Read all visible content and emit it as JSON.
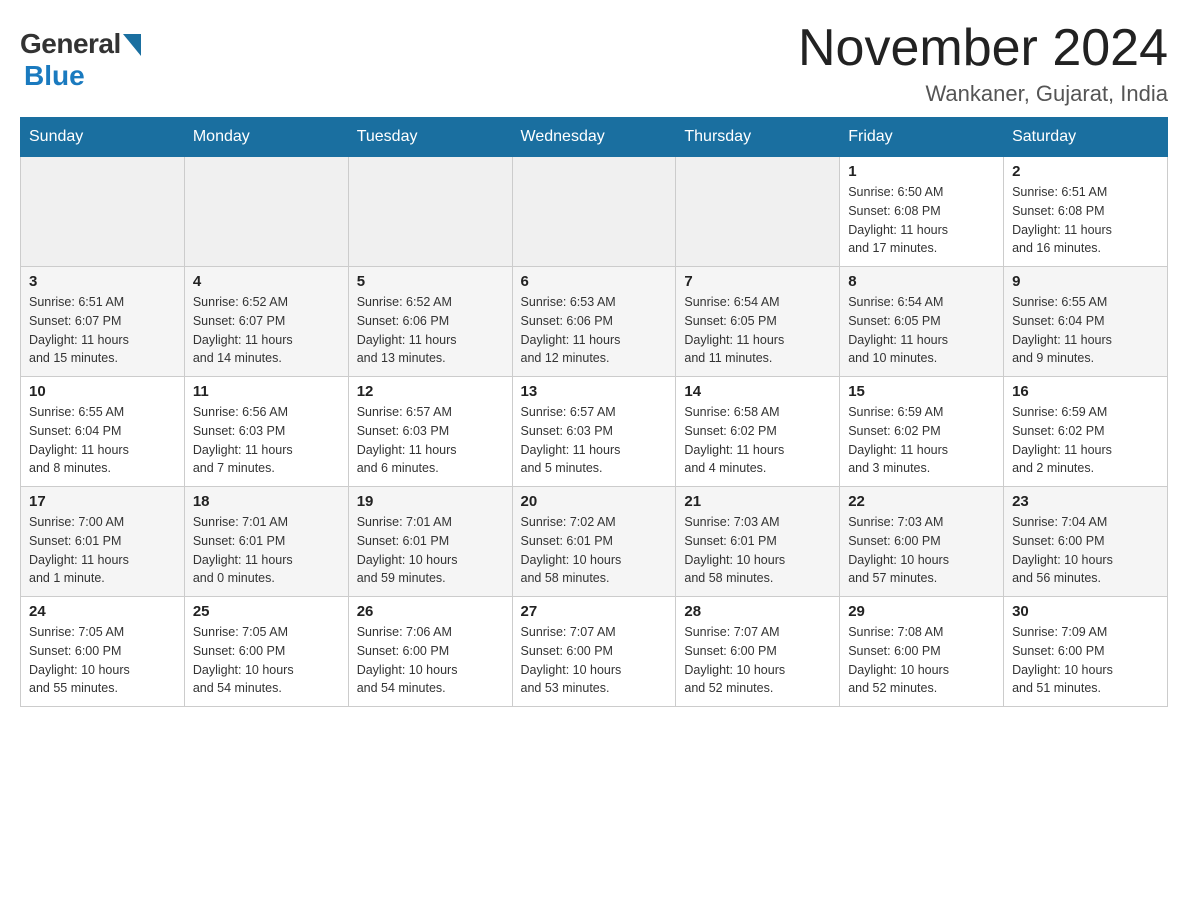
{
  "header": {
    "logo": {
      "general_text": "General",
      "blue_text": "Blue"
    },
    "title": "November 2024",
    "location": "Wankaner, Gujarat, India"
  },
  "days_of_week": [
    "Sunday",
    "Monday",
    "Tuesday",
    "Wednesday",
    "Thursday",
    "Friday",
    "Saturday"
  ],
  "weeks": [
    [
      {
        "day": "",
        "info": ""
      },
      {
        "day": "",
        "info": ""
      },
      {
        "day": "",
        "info": ""
      },
      {
        "day": "",
        "info": ""
      },
      {
        "day": "",
        "info": ""
      },
      {
        "day": "1",
        "info": "Sunrise: 6:50 AM\nSunset: 6:08 PM\nDaylight: 11 hours\nand 17 minutes."
      },
      {
        "day": "2",
        "info": "Sunrise: 6:51 AM\nSunset: 6:08 PM\nDaylight: 11 hours\nand 16 minutes."
      }
    ],
    [
      {
        "day": "3",
        "info": "Sunrise: 6:51 AM\nSunset: 6:07 PM\nDaylight: 11 hours\nand 15 minutes."
      },
      {
        "day": "4",
        "info": "Sunrise: 6:52 AM\nSunset: 6:07 PM\nDaylight: 11 hours\nand 14 minutes."
      },
      {
        "day": "5",
        "info": "Sunrise: 6:52 AM\nSunset: 6:06 PM\nDaylight: 11 hours\nand 13 minutes."
      },
      {
        "day": "6",
        "info": "Sunrise: 6:53 AM\nSunset: 6:06 PM\nDaylight: 11 hours\nand 12 minutes."
      },
      {
        "day": "7",
        "info": "Sunrise: 6:54 AM\nSunset: 6:05 PM\nDaylight: 11 hours\nand 11 minutes."
      },
      {
        "day": "8",
        "info": "Sunrise: 6:54 AM\nSunset: 6:05 PM\nDaylight: 11 hours\nand 10 minutes."
      },
      {
        "day": "9",
        "info": "Sunrise: 6:55 AM\nSunset: 6:04 PM\nDaylight: 11 hours\nand 9 minutes."
      }
    ],
    [
      {
        "day": "10",
        "info": "Sunrise: 6:55 AM\nSunset: 6:04 PM\nDaylight: 11 hours\nand 8 minutes."
      },
      {
        "day": "11",
        "info": "Sunrise: 6:56 AM\nSunset: 6:03 PM\nDaylight: 11 hours\nand 7 minutes."
      },
      {
        "day": "12",
        "info": "Sunrise: 6:57 AM\nSunset: 6:03 PM\nDaylight: 11 hours\nand 6 minutes."
      },
      {
        "day": "13",
        "info": "Sunrise: 6:57 AM\nSunset: 6:03 PM\nDaylight: 11 hours\nand 5 minutes."
      },
      {
        "day": "14",
        "info": "Sunrise: 6:58 AM\nSunset: 6:02 PM\nDaylight: 11 hours\nand 4 minutes."
      },
      {
        "day": "15",
        "info": "Sunrise: 6:59 AM\nSunset: 6:02 PM\nDaylight: 11 hours\nand 3 minutes."
      },
      {
        "day": "16",
        "info": "Sunrise: 6:59 AM\nSunset: 6:02 PM\nDaylight: 11 hours\nand 2 minutes."
      }
    ],
    [
      {
        "day": "17",
        "info": "Sunrise: 7:00 AM\nSunset: 6:01 PM\nDaylight: 11 hours\nand 1 minute."
      },
      {
        "day": "18",
        "info": "Sunrise: 7:01 AM\nSunset: 6:01 PM\nDaylight: 11 hours\nand 0 minutes."
      },
      {
        "day": "19",
        "info": "Sunrise: 7:01 AM\nSunset: 6:01 PM\nDaylight: 10 hours\nand 59 minutes."
      },
      {
        "day": "20",
        "info": "Sunrise: 7:02 AM\nSunset: 6:01 PM\nDaylight: 10 hours\nand 58 minutes."
      },
      {
        "day": "21",
        "info": "Sunrise: 7:03 AM\nSunset: 6:01 PM\nDaylight: 10 hours\nand 58 minutes."
      },
      {
        "day": "22",
        "info": "Sunrise: 7:03 AM\nSunset: 6:00 PM\nDaylight: 10 hours\nand 57 minutes."
      },
      {
        "day": "23",
        "info": "Sunrise: 7:04 AM\nSunset: 6:00 PM\nDaylight: 10 hours\nand 56 minutes."
      }
    ],
    [
      {
        "day": "24",
        "info": "Sunrise: 7:05 AM\nSunset: 6:00 PM\nDaylight: 10 hours\nand 55 minutes."
      },
      {
        "day": "25",
        "info": "Sunrise: 7:05 AM\nSunset: 6:00 PM\nDaylight: 10 hours\nand 54 minutes."
      },
      {
        "day": "26",
        "info": "Sunrise: 7:06 AM\nSunset: 6:00 PM\nDaylight: 10 hours\nand 54 minutes."
      },
      {
        "day": "27",
        "info": "Sunrise: 7:07 AM\nSunset: 6:00 PM\nDaylight: 10 hours\nand 53 minutes."
      },
      {
        "day": "28",
        "info": "Sunrise: 7:07 AM\nSunset: 6:00 PM\nDaylight: 10 hours\nand 52 minutes."
      },
      {
        "day": "29",
        "info": "Sunrise: 7:08 AM\nSunset: 6:00 PM\nDaylight: 10 hours\nand 52 minutes."
      },
      {
        "day": "30",
        "info": "Sunrise: 7:09 AM\nSunset: 6:00 PM\nDaylight: 10 hours\nand 51 minutes."
      }
    ]
  ]
}
